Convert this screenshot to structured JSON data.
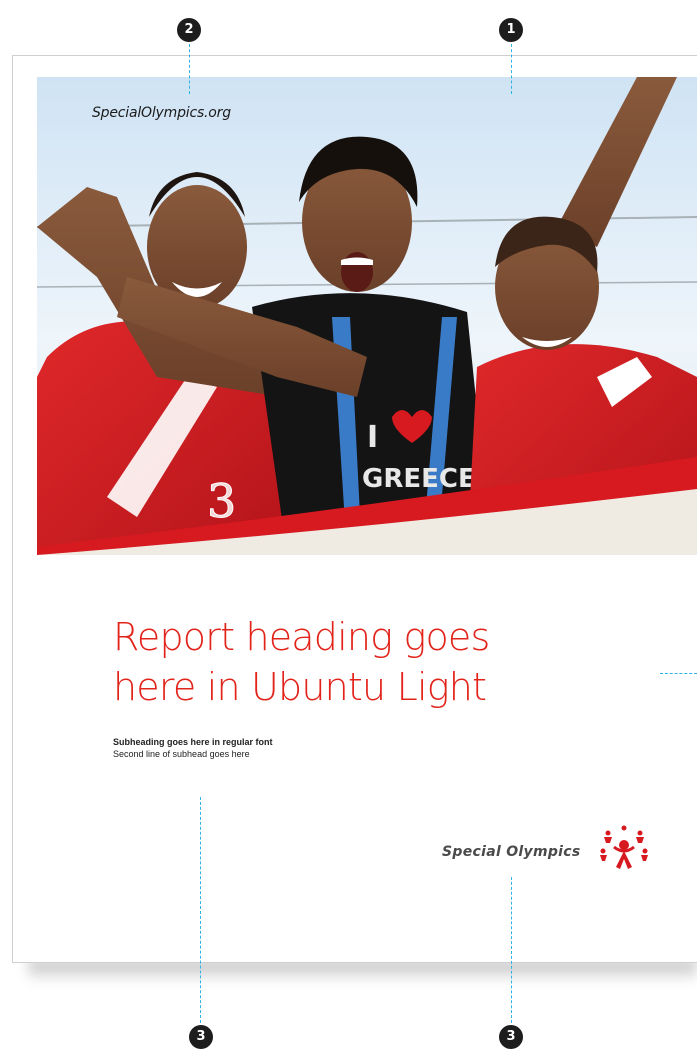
{
  "document": {
    "website": "SpecialOlympics.org",
    "heading_line1": "Report heading goes",
    "heading_line2": "here in Ubuntu Light",
    "subheading_bold": "Subheading goes here in regular font",
    "subheading_regular": "Second line of subhead goes here",
    "logo_text": "Special Olympics"
  },
  "annotations": {
    "marker_1": "1",
    "marker_2": "2",
    "marker_3a": "3",
    "marker_3b": "3"
  },
  "colors": {
    "heading": "#e2231a",
    "accent_red": "#d71920",
    "annotation_line": "#2fb3e6",
    "marker_bg": "#1d1d1d"
  },
  "icons": {
    "logo": "special-olympics-logo-icon"
  }
}
